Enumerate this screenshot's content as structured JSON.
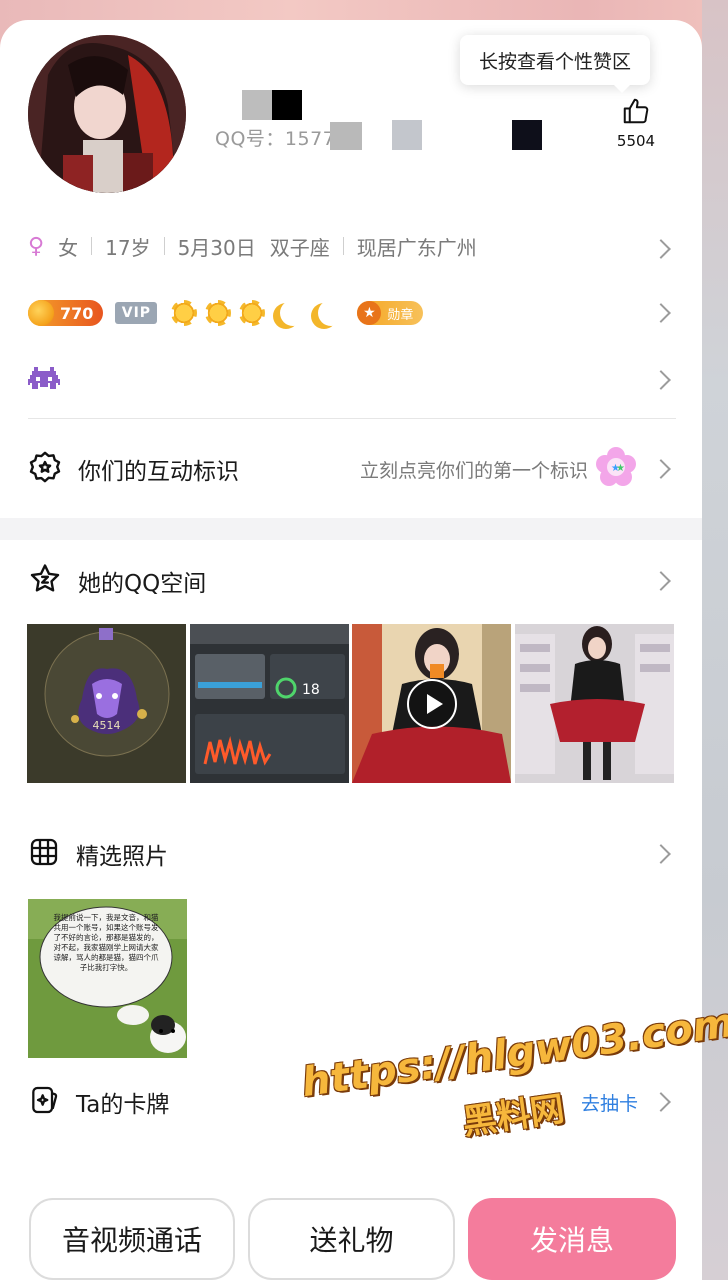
{
  "profile": {
    "qq_label": "QQ号：1577",
    "likes": "5504",
    "tooltip": "长按查看个性赞区"
  },
  "info": {
    "gender": "女",
    "age": "17岁",
    "birthday": "5月30日",
    "zodiac": "双子座",
    "location": "现居广东广州"
  },
  "level": {
    "coins": "770",
    "vip": "VIP",
    "medal": "勋章"
  },
  "interaction": {
    "title": "你们的互动标识",
    "hint": "立刻点亮你们的第一个标识"
  },
  "qzone": {
    "title": "她的QQ空间",
    "photo1_text": "4514"
  },
  "featured": {
    "title": "精选照片",
    "note": "我提前说一下，我是文音，和猫共用一个账号，如果这个账号发了不好的言论，那都是猫发的，对不起，我家猫刚学上网请大家谅解，骂人的都是猫，猫四个爪子比我打字快。"
  },
  "cards": {
    "title": "Ta的卡牌",
    "action": "去抽卡"
  },
  "watermark": {
    "url": "https://hlgw03.com",
    "name": "黑料网"
  },
  "buttons": {
    "call": "音视频通话",
    "gift": "送礼物",
    "message": "发消息"
  },
  "colors": {
    "accent_pink": "#f47c9c",
    "female": "#d77ad4",
    "link_blue": "#2f7fe0"
  }
}
